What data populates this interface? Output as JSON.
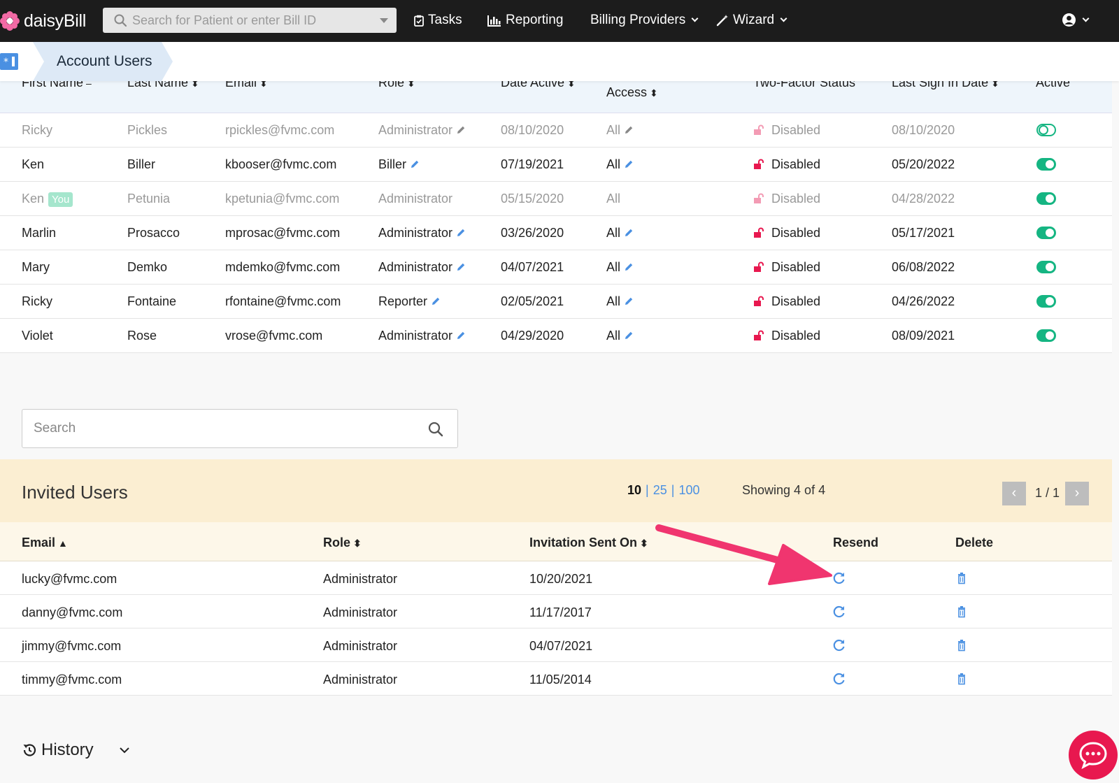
{
  "app": {
    "name": "daisyBill"
  },
  "topbar": {
    "search_placeholder": "Search for Patient or enter Bill ID",
    "tasks": "Tasks",
    "reporting": "Reporting",
    "billing_providers": "Billing Providers",
    "wizard": "Wizard"
  },
  "breadcrumb": {
    "label": "Account Users"
  },
  "users_table": {
    "headers": {
      "first_name": "First Name",
      "last_name": "Last Name",
      "email": "Email",
      "role": "Role",
      "date_active": "Date Active",
      "access": "Access",
      "two_factor": "Two-Factor Status",
      "last_sign_in": "Last Sign In Date",
      "active": "Active"
    },
    "you_badge": "You",
    "rows": [
      {
        "first": "Ricky",
        "last": "Pickles",
        "email": "rpickles@fvmc.com",
        "role": "Administrator",
        "date_active": "08/10/2020",
        "access": "All",
        "two_factor": "Disabled",
        "last_sign_in": "08/10/2020",
        "active": false
      },
      {
        "first": "Ken",
        "last": "Biller",
        "email": "kbooser@fvmc.com",
        "role": "Biller",
        "date_active": "07/19/2021",
        "access": "All",
        "two_factor": "Disabled",
        "last_sign_in": "05/20/2022",
        "active": true
      },
      {
        "first": "Ken",
        "last": "Petunia",
        "email": "kpetunia@fvmc.com",
        "role": "Administrator",
        "date_active": "05/15/2020",
        "access": "All",
        "two_factor": "Disabled",
        "last_sign_in": "04/28/2022",
        "active": true
      },
      {
        "first": "Marlin",
        "last": "Prosacco",
        "email": "mprosac@fvmc.com",
        "role": "Administrator",
        "date_active": "03/26/2020",
        "access": "All",
        "two_factor": "Disabled",
        "last_sign_in": "05/17/2021",
        "active": true
      },
      {
        "first": "Mary",
        "last": "Demko",
        "email": "mdemko@fvmc.com",
        "role": "Administrator",
        "date_active": "04/07/2021",
        "access": "All",
        "two_factor": "Disabled",
        "last_sign_in": "06/08/2022",
        "active": true
      },
      {
        "first": "Ricky",
        "last": "Fontaine",
        "email": "rfontaine@fvmc.com",
        "role": "Reporter",
        "date_active": "02/05/2021",
        "access": "All",
        "two_factor": "Disabled",
        "last_sign_in": "04/26/2022",
        "active": true
      },
      {
        "first": "Violet",
        "last": "Rose",
        "email": "vrose@fvmc.com",
        "role": "Administrator",
        "date_active": "04/29/2020",
        "access": "All",
        "two_factor": "Disabled",
        "last_sign_in": "08/09/2021",
        "active": true
      }
    ]
  },
  "invited_search": {
    "placeholder": "Search"
  },
  "invited": {
    "title": "Invited Users",
    "per_page": [
      "10",
      "25",
      "100"
    ],
    "showing": "Showing 4 of 4",
    "page": "1 / 1",
    "headers": {
      "email": "Email",
      "role": "Role",
      "sent_on": "Invitation Sent On",
      "resend": "Resend",
      "delete": "Delete"
    },
    "rows": [
      {
        "email": "lucky@fvmc.com",
        "role": "Administrator",
        "sent_on": "10/20/2021"
      },
      {
        "email": "danny@fvmc.com",
        "role": "Administrator",
        "sent_on": "11/17/2017"
      },
      {
        "email": "jimmy@fvmc.com",
        "role": "Administrator",
        "sent_on": "04/07/2021"
      },
      {
        "email": "timmy@fvmc.com",
        "role": "Administrator",
        "sent_on": "11/05/2014"
      }
    ]
  },
  "history": {
    "label": "History"
  },
  "colors": {
    "accent": "#4a90e2",
    "toggle_on": "#15b582",
    "lock": "#e8184f",
    "topbar": "#1c1c1c",
    "annotation_arrow": "#f0356f"
  }
}
